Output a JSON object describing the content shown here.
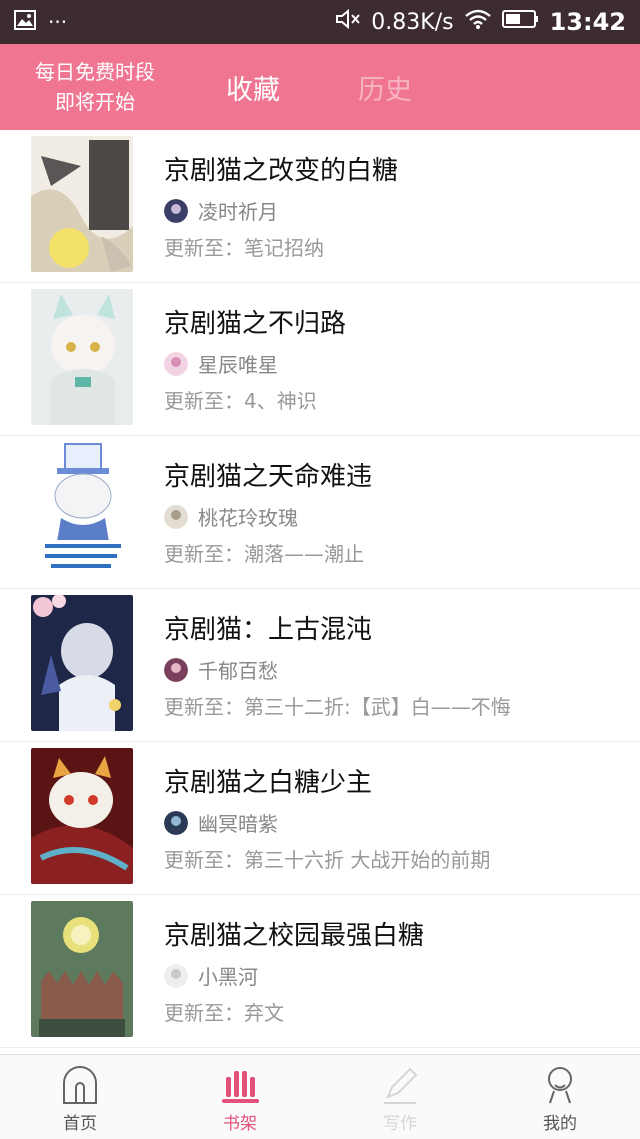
{
  "status_bar": {
    "network_speed": "0.83K/s",
    "time": "13:42",
    "icons": [
      "image-icon",
      "more-dots-icon",
      "mute-icon",
      "wifi-icon",
      "battery-icon"
    ]
  },
  "header": {
    "promo_line1": "每日免费时段",
    "promo_line2": "即将开始",
    "tab_favorites": "收藏",
    "tab_history": "历史",
    "bg_color": "#ef7591"
  },
  "books": [
    {
      "title": "京剧猫之改变的白糖",
      "author": "凌时祈月",
      "update_label": "更新至：",
      "update": "笔记招纳",
      "cover_icon": "cover-art",
      "avatar_icon": "author-avatar"
    },
    {
      "title": "京剧猫之不归路",
      "author": "星辰唯星",
      "update_label": "更新至：",
      "update": "4、神识",
      "cover_icon": "cover-art",
      "avatar_icon": "author-avatar"
    },
    {
      "title": "京剧猫之天命难违",
      "author": "桃花玲玫瑰",
      "update_label": "更新至：",
      "update": "潮落——潮止",
      "cover_icon": "cover-art",
      "avatar_icon": "author-avatar"
    },
    {
      "title": "京剧猫：上古混沌",
      "author": "千郁百愁",
      "update_label": "更新至：",
      "update": "第三十二折:【武】白——不悔",
      "cover_icon": "cover-art",
      "avatar_icon": "author-avatar"
    },
    {
      "title": "京剧猫之白糖少主",
      "author": "幽冥暗紫",
      "update_label": "更新至：",
      "update": "第三十六折 大战开始的前期",
      "cover_icon": "cover-art",
      "avatar_icon": "author-avatar"
    },
    {
      "title": "京剧猫之校园最强白糖",
      "author": "小黑河",
      "update_label": "更新至：",
      "update": "弃文",
      "cover_icon": "cover-art",
      "avatar_icon": "author-avatar"
    }
  ],
  "bottom_nav": {
    "home": "首页",
    "bookshelf": "书架",
    "write": "写作",
    "mine": "我的",
    "active_color": "#e3517a"
  }
}
